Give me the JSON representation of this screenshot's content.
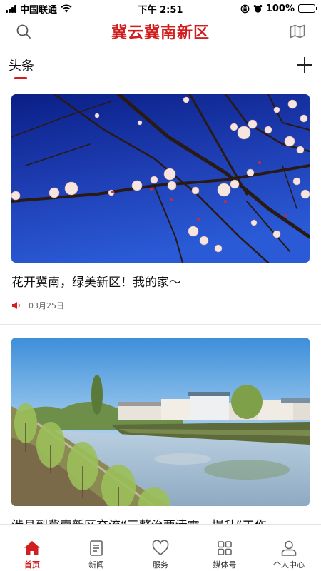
{
  "status_bar": {
    "carrier": "中国联通",
    "time": "下午 2:51",
    "battery": "100%"
  },
  "header": {
    "title": "冀云冀南新区",
    "search_icon": "search-icon",
    "map_icon": "map-icon",
    "brand_color": "#d11f1f"
  },
  "tabs": {
    "active": "头条",
    "add_icon": "plus-icon"
  },
  "articles": [
    {
      "title": "花开冀南，绿美新区！我的家～",
      "date": "03月25日",
      "audio_icon": "speaker-icon",
      "image": "plum-blossom-photo"
    },
    {
      "title": "涉县到冀南新区交流“三整治两清零一提升”工作",
      "image": "river-village-photo"
    }
  ],
  "bottom_nav": [
    {
      "label": "首页",
      "icon": "home-icon",
      "active": true
    },
    {
      "label": "新闻",
      "icon": "news-icon",
      "active": false
    },
    {
      "label": "服务",
      "icon": "heart-icon",
      "active": false
    },
    {
      "label": "媒体号",
      "icon": "grid-icon",
      "active": false
    },
    {
      "label": "个人中心",
      "icon": "user-icon",
      "active": false
    }
  ]
}
